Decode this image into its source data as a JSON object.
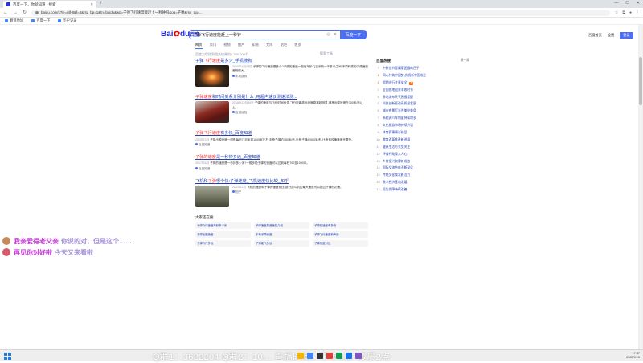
{
  "browser": {
    "tab_title": "百度一下，你就知道 - 搜索",
    "new_tab": "+",
    "window_controls": [
      "—",
      "☐",
      "✕"
    ],
    "url": "baidu.com/s?ie=utf-8&f=8&rsv_bp=1&tn=baidu&wd=子弹飞行速度能赶上一秒钟吗&oq=子弹&rsv_pq=...",
    "bookmarks": [
      "翻译地址",
      "百度一下",
      "历史记录"
    ]
  },
  "baidu": {
    "logo_a": "Bai",
    "logo_b": "du",
    "logo_c": "百度",
    "query": "子弹飞行速度能赶上一秒钟",
    "search_button": "百度一下",
    "top_links": [
      "百度首页",
      "设置",
      "登录"
    ],
    "tabs": [
      "网页",
      "资讯",
      "视频",
      "图片",
      "知道",
      "文库",
      "贴吧",
      "更多"
    ],
    "hint": "百度为您找到相关结果约1,390,000个",
    "tools": "搜索工具"
  },
  "results": [
    {
      "title_pre": "子弹",
      "title_em": "飞行速度",
      "title_post": "是多少_手机搜狗",
      "thumb_color": "#3a2a1a",
      "date": "2020年4月29日",
      "text": "子弹的飞行速度是多少?子弹的速度一般在每秒几百米到一千多米之间,不同种类的子弹速度差别很大。",
      "source": "手机搜狗"
    },
    {
      "title_pre": "",
      "title_em": "子弹速度",
      "title_post": "和时间关系分别是什么 ,用超声速仪测速法测...",
      "thumb_color": "#7a1e1e",
      "date": "2018年12月30日",
      "text": "子弹的速度与飞行时间有关,飞行距离越远速度衰减越明显,通常出膛速度在300米/秒以上。",
      "source": "百度经验"
    },
    {
      "title_pre": "",
      "title_em": "子弹飞行速度",
      "title_post": "有多快_百度知道",
      "thumb_color": "",
      "date": "2019年3月",
      "text": "子弹出膛速度一般是每秒几百米到1000米左右,手枪子弹约350米/秒,步枪子弹约900米/秒,比声音传播速度还要快。",
      "source": "百度知道"
    },
    {
      "title_pre": "",
      "title_em": "子弹的速度",
      "title_post": "是一秒钟多远_百度知道",
      "thumb_color": "",
      "date": "2017年6月",
      "text": "子弹的速度是一秒钟多少米?一般步枪子弹的速度可以达到每秒700至1000米。",
      "source": "百度知道"
    },
    {
      "title_pre": "飞机和",
      "title_em": "子弹",
      "title_post": "哪个快:子弹速度_飞机速度快比较_知乎",
      "thumb_color": "#6b6f5a",
      "date": "2021年2月",
      "text": "飞机的速度和子弹的速度相比,部分战斗机的最大速度可以超过子弹的初速。",
      "source": "知乎"
    }
  ],
  "related": {
    "title": "大家还在搜",
    "items": [
      "子弹飞行速度每秒多少米",
      "子弹速度是音速的几倍",
      "子弹的速度有多快",
      "子弹出膛速度",
      "手枪子弹速度",
      "子弹飞行速度和声速",
      "子弹飞行多远",
      "子弹能飞多远",
      "子弹速度对比"
    ]
  },
  "hot": {
    "title": "百度热搜",
    "change": "换一换",
    "items": [
      "中秋佳节是阖家团圆的日子",
      "同心共筑中国梦,庆祝新中国成立",
      "假期出行注意安全",
      "全国各地迎来丰收时节",
      "多地发布天气预报提醒",
      "科技创新驱动高质量发展",
      "城市夜景灯光秀美轮美奂",
      "新能源汽车销量持续增长",
      "文化旅游市场持续升温",
      "体育赛事精彩纷呈",
      "教育改革推进新进展",
      "健康生活方式受关注",
      "环保行动深入人心",
      "乡村振兴取得新成效",
      "国际交流合作不断深化",
      "传统文化焕发新活力",
      "数字经济蓬勃发展",
      "民生保障持续改善"
    ]
  },
  "danmu": [
    {
      "user": "我亲爱得老父亲",
      "msg": "你说的对，但是这个……"
    },
    {
      "user": "再见你对好啦",
      "msg": "今天又来看啦"
    }
  ],
  "taskbar": {
    "overlay": "Q群1：3622204    Q群2：10…    直播时间：下午4点~凌晨2点",
    "time": "17:37",
    "date": "2022/9/10"
  }
}
